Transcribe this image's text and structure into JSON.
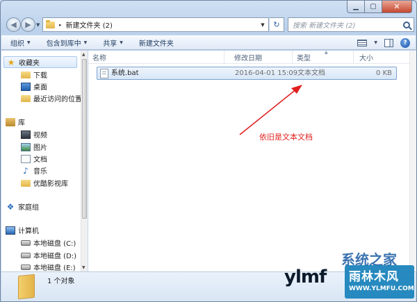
{
  "window": {
    "min_label": "▁",
    "max_label": "▢",
    "close_label": "✕"
  },
  "nav": {
    "back_glyph": "◀",
    "forward_glyph": "▶",
    "address_separator": "▸",
    "address_path": "新建文件夹 (2)",
    "refresh_glyph": "↻",
    "search_placeholder": "搜索 新建文件夹 (2)"
  },
  "toolbar": {
    "organize": "组织",
    "include_library": "包含到库中",
    "share": "共享",
    "new_folder": "新建文件夹",
    "help": "?"
  },
  "sidebar": {
    "favorites": "收藏夹",
    "downloads": "下载",
    "desktop": "桌面",
    "recent": "最近访问的位置",
    "libraries": "库",
    "videos": "视频",
    "pictures": "图片",
    "documents": "文档",
    "music": "音乐",
    "youku": "优酷影视库",
    "homegroup": "家庭组",
    "computer": "计算机",
    "disk_c": "本地磁盘 (C:)",
    "disk_d": "本地磁盘 (D:)",
    "disk_e": "本地磁盘 (E:)"
  },
  "columns": {
    "name": "名称",
    "date": "修改日期",
    "type": "类型",
    "size": "大小"
  },
  "files": [
    {
      "name": "系统.bat",
      "date": "2016-04-01 15:09",
      "type": "文本文档",
      "size": "0 KB"
    }
  ],
  "annotation": {
    "text": "依旧是文本文档",
    "color": "#e02020"
  },
  "details": {
    "count": "1 个对象"
  },
  "watermark": {
    "brand": "系统之家",
    "site": "ylmf",
    "box_cn": "雨林木风",
    "box_url": "WWW.YLMFU.COM"
  }
}
